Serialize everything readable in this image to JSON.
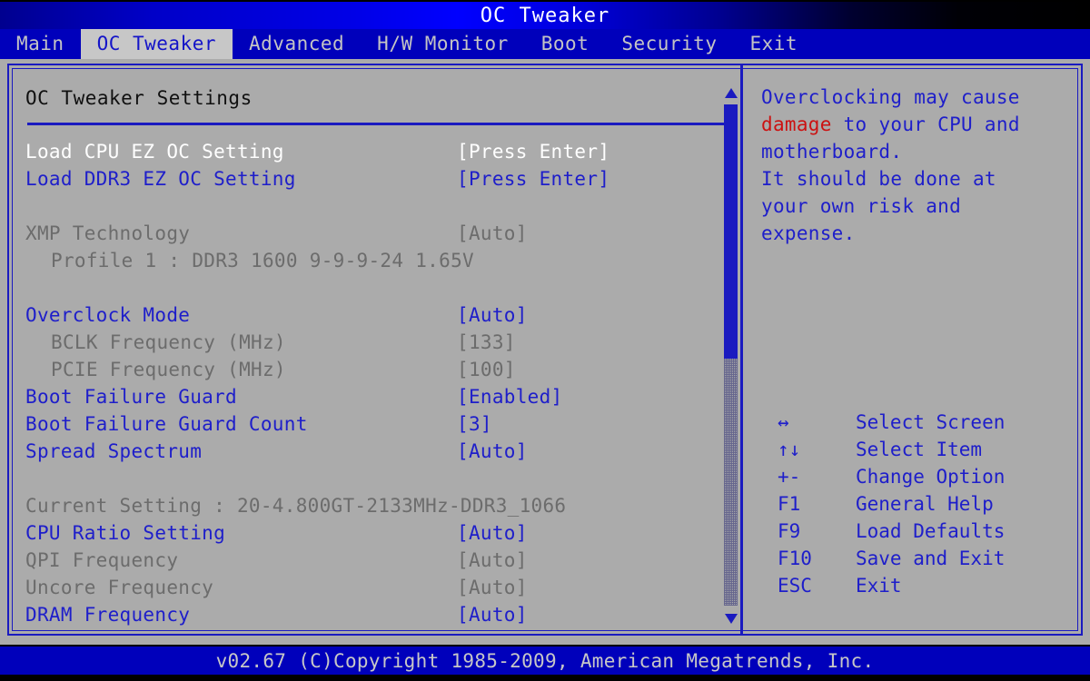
{
  "window": {
    "title": "OC Tweaker"
  },
  "colors": {
    "menubar_blue": "#0000bb",
    "frame_blue": "#1a1ac0",
    "panel_gray": "#ababab",
    "text_blue": "#1e1eca",
    "text_gray": "#6c6c6c",
    "text_white": "#ffffff",
    "warning_red": "#cc1111",
    "selected_tab_bg": "#c7c7c7"
  },
  "menubar": {
    "tabs": [
      {
        "label": "Main",
        "selected": false
      },
      {
        "label": "OC Tweaker",
        "selected": true
      },
      {
        "label": "Advanced",
        "selected": false
      },
      {
        "label": "H/W Monitor",
        "selected": false
      },
      {
        "label": "Boot",
        "selected": false
      },
      {
        "label": "Security",
        "selected": false
      },
      {
        "label": "Exit",
        "selected": false
      }
    ]
  },
  "settings_pane": {
    "title": "OC Tweaker Settings",
    "rows": [
      {
        "label": "Load CPU EZ OC Setting",
        "value": "[Press Enter]",
        "style": "white",
        "indent": false
      },
      {
        "label": "Load DDR3 EZ OC Setting",
        "value": "[Press Enter]",
        "style": "blue",
        "indent": false
      },
      {
        "label": "",
        "value": "",
        "style": "spacer",
        "indent": false
      },
      {
        "label": "XMP Technology",
        "value": "[Auto]",
        "style": "gray",
        "indent": false
      },
      {
        "label": "Profile 1 : DDR3 1600 9-9-9-24 1.65V",
        "value": "",
        "style": "gray",
        "indent": true
      },
      {
        "label": "",
        "value": "",
        "style": "spacer",
        "indent": false
      },
      {
        "label": "Overclock Mode",
        "value": "[Auto]",
        "style": "blue",
        "indent": false
      },
      {
        "label": "BCLK Frequency (MHz)",
        "value": "[133]",
        "style": "gray",
        "indent": true
      },
      {
        "label": "PCIE Frequency (MHz)",
        "value": "[100]",
        "style": "gray",
        "indent": true
      },
      {
        "label": "Boot Failure Guard",
        "value": "[Enabled]",
        "style": "blue",
        "indent": false
      },
      {
        "label": "Boot Failure Guard Count",
        "value": "[3]",
        "style": "blue",
        "indent": false
      },
      {
        "label": "Spread Spectrum",
        "value": "[Auto]",
        "style": "blue",
        "indent": false
      },
      {
        "label": "",
        "value": "",
        "style": "spacer",
        "indent": false
      },
      {
        "label": "Current Setting : 20-4.800GT-2133MHz-DDR3_1066",
        "value": "",
        "style": "gray",
        "indent": false
      },
      {
        "label": "CPU Ratio Setting",
        "value": "[Auto]",
        "style": "blue",
        "indent": false
      },
      {
        "label": "QPI Frequency",
        "value": "[Auto]",
        "style": "gray",
        "indent": false
      },
      {
        "label": "Uncore Frequency",
        "value": "[Auto]",
        "style": "gray",
        "indent": false
      },
      {
        "label": "DRAM Frequency",
        "value": "[Auto]",
        "style": "blue",
        "indent": false
      }
    ]
  },
  "scrollbar": {
    "up_arrow": "scroll-up-arrow",
    "down_arrow": "scroll-down-arrow"
  },
  "help_pane": {
    "text_before": "Overclocking may cause\n",
    "text_highlight": "damage",
    "text_after": " to your CPU and\nmotherboard.\nIt should be done at\nyour own risk and\nexpense.",
    "keys": [
      {
        "key": "↔",
        "desc": "Select Screen"
      },
      {
        "key": "↑↓",
        "desc": "Select Item"
      },
      {
        "key": "+-",
        "desc": "Change Option"
      },
      {
        "key": "F1",
        "desc": "General Help"
      },
      {
        "key": "F9",
        "desc": "Load Defaults"
      },
      {
        "key": "F10",
        "desc": "Save and Exit"
      },
      {
        "key": "ESC",
        "desc": "Exit"
      }
    ]
  },
  "footer": {
    "text": "v02.67 (C)Copyright 1985-2009, American Megatrends, Inc."
  }
}
